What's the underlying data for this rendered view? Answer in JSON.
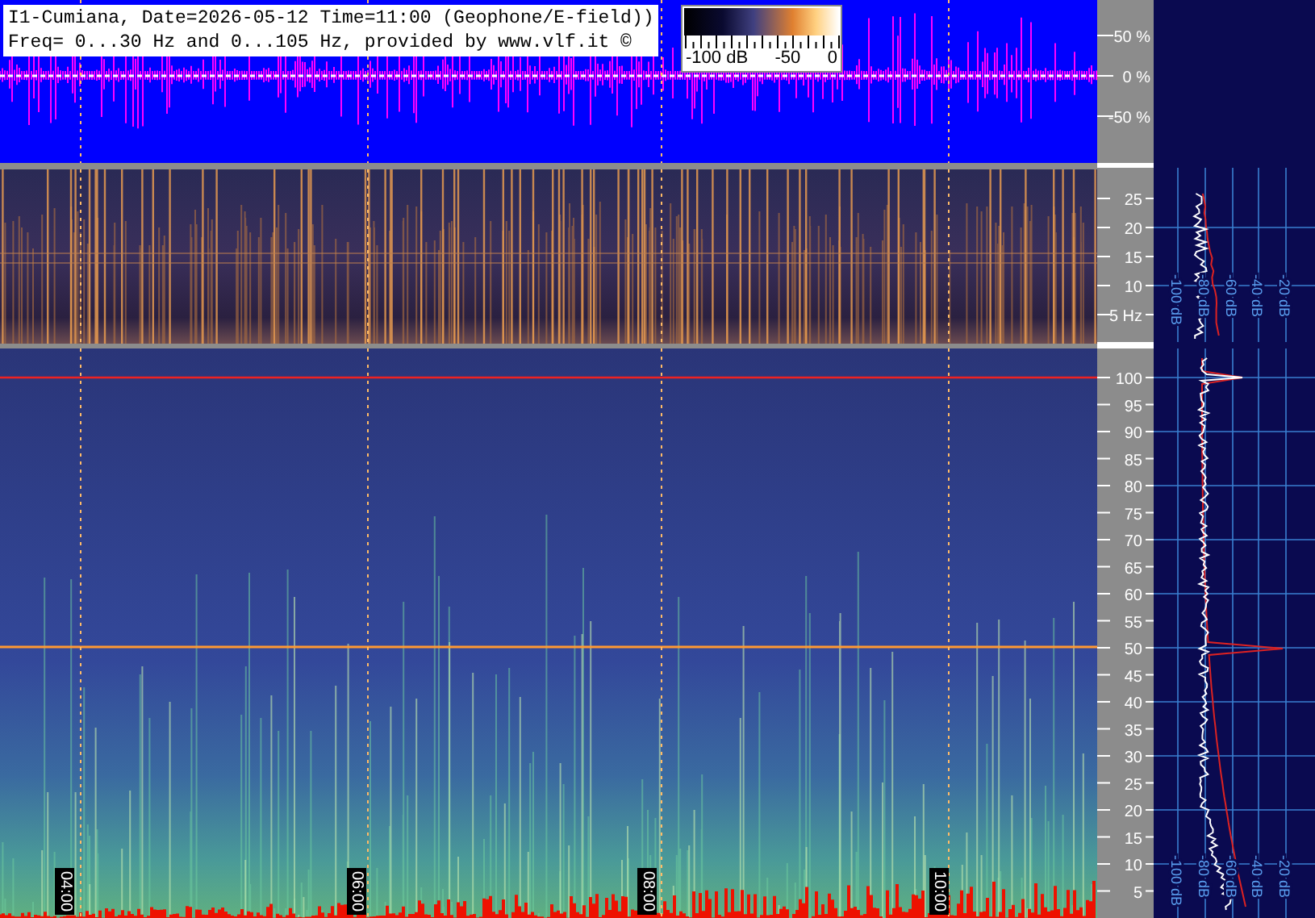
{
  "header": {
    "line_1": "I1-Cumiana, Date=2026-05-12 Time=11:00 (Geophone/E-field))",
    "line_2": "Freq= 0...30 Hz and 0...105 Hz, provided by www.vlf.it ©"
  },
  "color_scale": {
    "labels": [
      "-100 dB",
      "-50",
      "0"
    ]
  },
  "waveform_axis": [
    "50 %",
    "0 %",
    "-50 %"
  ],
  "low_frequency_axis": [
    "25",
    "20",
    "15",
    "10",
    "5 Hz"
  ],
  "high_frequency_axis": [
    "100",
    "95",
    "90",
    "85",
    "80",
    "75",
    "70",
    "65",
    "60",
    "55",
    "50",
    "45",
    "40",
    "35",
    "30",
    "25",
    "20",
    "15",
    "10",
    "5"
  ],
  "time_labels": [
    "04:00",
    "06:00",
    "08:00",
    "10:00"
  ],
  "low_spectrum_labels": [
    "-100 dB",
    "-80 dB",
    "-60 dB",
    "-40 dB",
    "-20 dB"
  ],
  "high_spectrum_labels": [
    "-100 dB",
    "-80 dB",
    "-60 dB",
    "-40 dB",
    "-20 dB"
  ]
}
